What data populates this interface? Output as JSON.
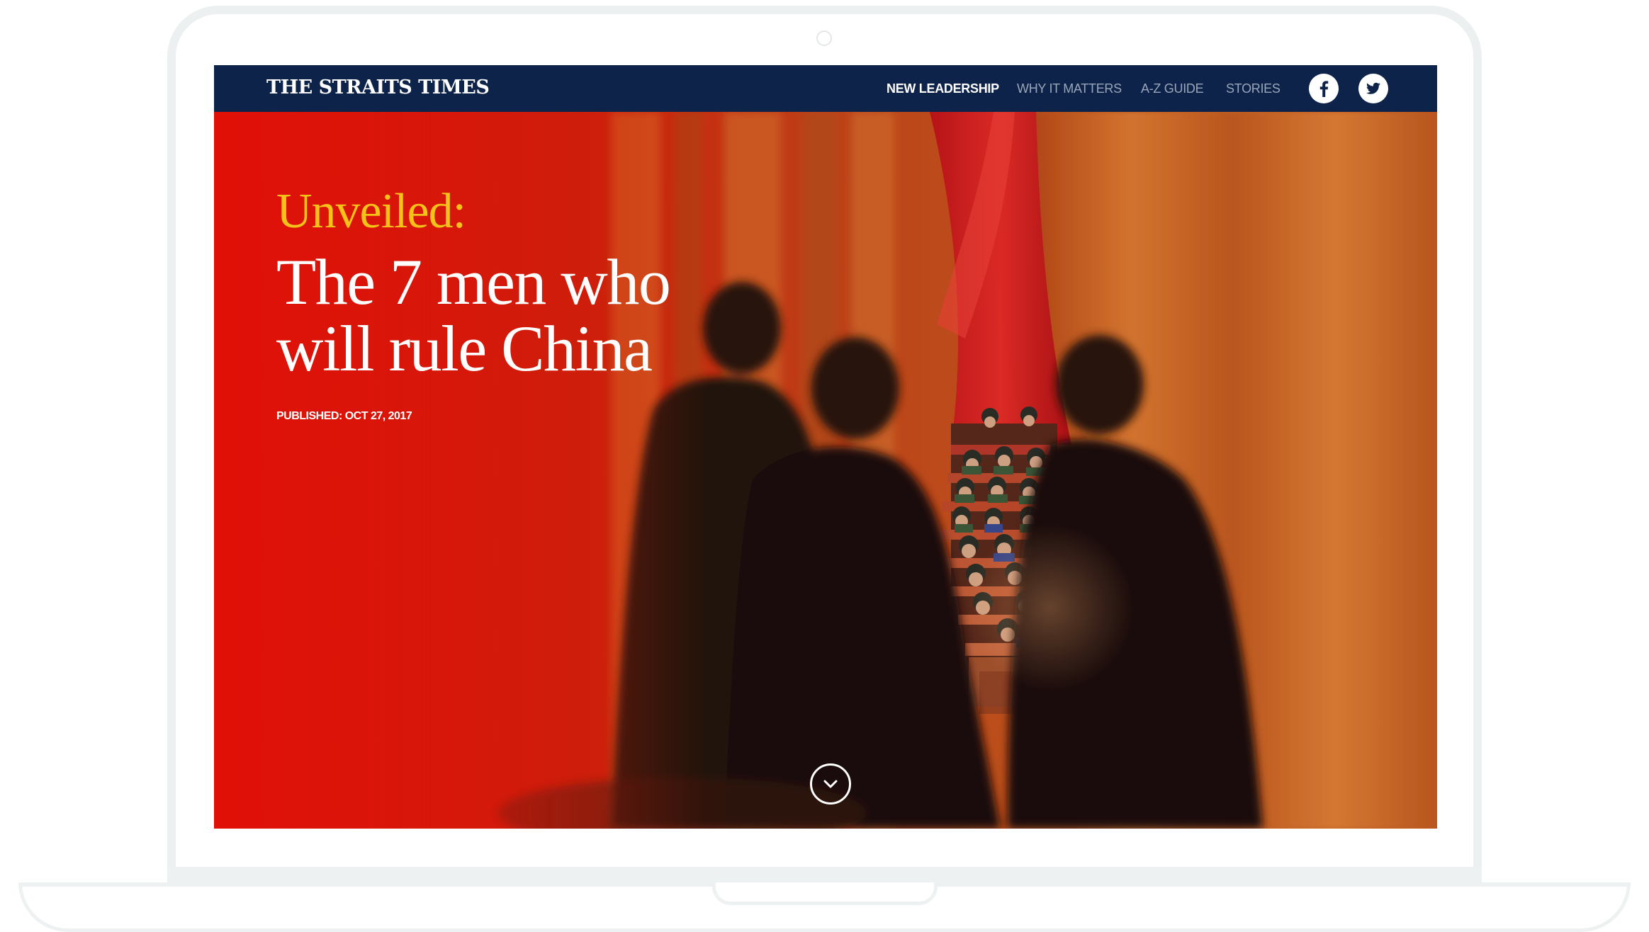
{
  "header": {
    "brand": "THE STRAITS TIMES",
    "nav": [
      {
        "label": "NEW LEADERSHIP",
        "active": true
      },
      {
        "label": "WHY IT MATTERS",
        "active": false
      },
      {
        "label": "A-Z GUIDE",
        "active": false
      },
      {
        "label": "STORIES",
        "active": false
      }
    ],
    "social": [
      {
        "icon": "facebook-icon"
      },
      {
        "icon": "twitter-icon"
      }
    ]
  },
  "hero": {
    "kicker": "Unveiled:",
    "headline": "The 7 men who will rule China",
    "published": "PUBLISHED: OCT 27, 2017",
    "scroll_icon": "chevron-down-icon",
    "image": "photo-silhouettes-in-front-of-red-curtain-and-congress-delegates"
  },
  "colors": {
    "navbar": "#0e2349",
    "kicker": "#f5c218",
    "hero_red": "#e3180c",
    "curtain_orange": "#d45e1e"
  }
}
